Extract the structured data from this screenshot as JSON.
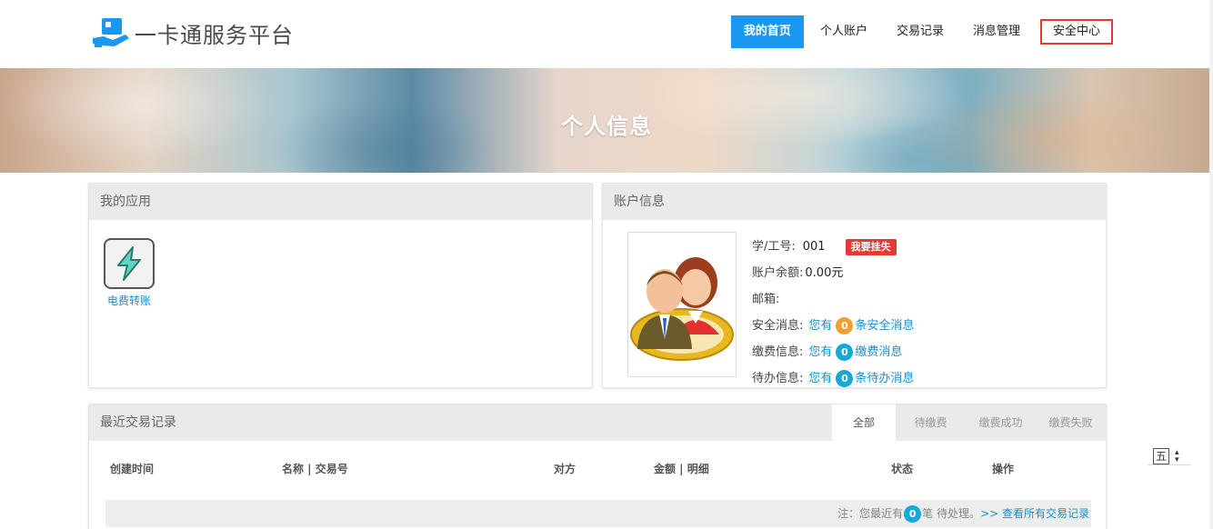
{
  "header": {
    "logo_text": "一卡通服务平台",
    "nav": [
      {
        "label": "我的首页",
        "state": "active"
      },
      {
        "label": "个人账户",
        "state": "normal"
      },
      {
        "label": "交易记录",
        "state": "normal"
      },
      {
        "label": "消息管理",
        "state": "normal"
      },
      {
        "label": "安全中心",
        "state": "outlined"
      }
    ]
  },
  "banner": {
    "title": "个人信息"
  },
  "apps": {
    "title": "我的应用",
    "items": [
      {
        "label": "电费转账",
        "icon": "lightning-icon"
      }
    ]
  },
  "account": {
    "title": "账户信息",
    "student_id_label": "学/工号:",
    "student_id": "001",
    "report_loss_button": "我要挂失",
    "balance_label": "账户余额:",
    "balance": "0.00元",
    "email_label": "邮箱:",
    "email": "",
    "security_label": "安全消息:",
    "security_prefix": "您有",
    "security_count": "0",
    "security_suffix": "条安全消息",
    "payment_label": "缴费信息:",
    "payment_prefix": "您有",
    "payment_count": "0",
    "payment_suffix": "缴费消息",
    "todo_label": "待办信息:",
    "todo_prefix": "您有",
    "todo_count": "0",
    "todo_suffix": "条待办消息"
  },
  "transactions": {
    "title": "最近交易记录",
    "tabs": [
      "全部",
      "待缴费",
      "缴费成功",
      "缴费失败"
    ],
    "active_tab": "全部",
    "columns": [
      "创建时间",
      "名称 | 交易号",
      "对方",
      "金额 | 明细",
      "状态",
      "操作"
    ],
    "note_prefix": "注：您最近有",
    "note_count": "0",
    "note_suffix": "笔 待处理。",
    "view_all": ">> 查看所有交易记录"
  },
  "side_widget": {
    "char": "五"
  },
  "colors": {
    "accent": "#1a97f0",
    "danger": "#e53935",
    "link": "#1a8fd0",
    "orange": "#f0a030",
    "teal": "#16a8d8"
  }
}
